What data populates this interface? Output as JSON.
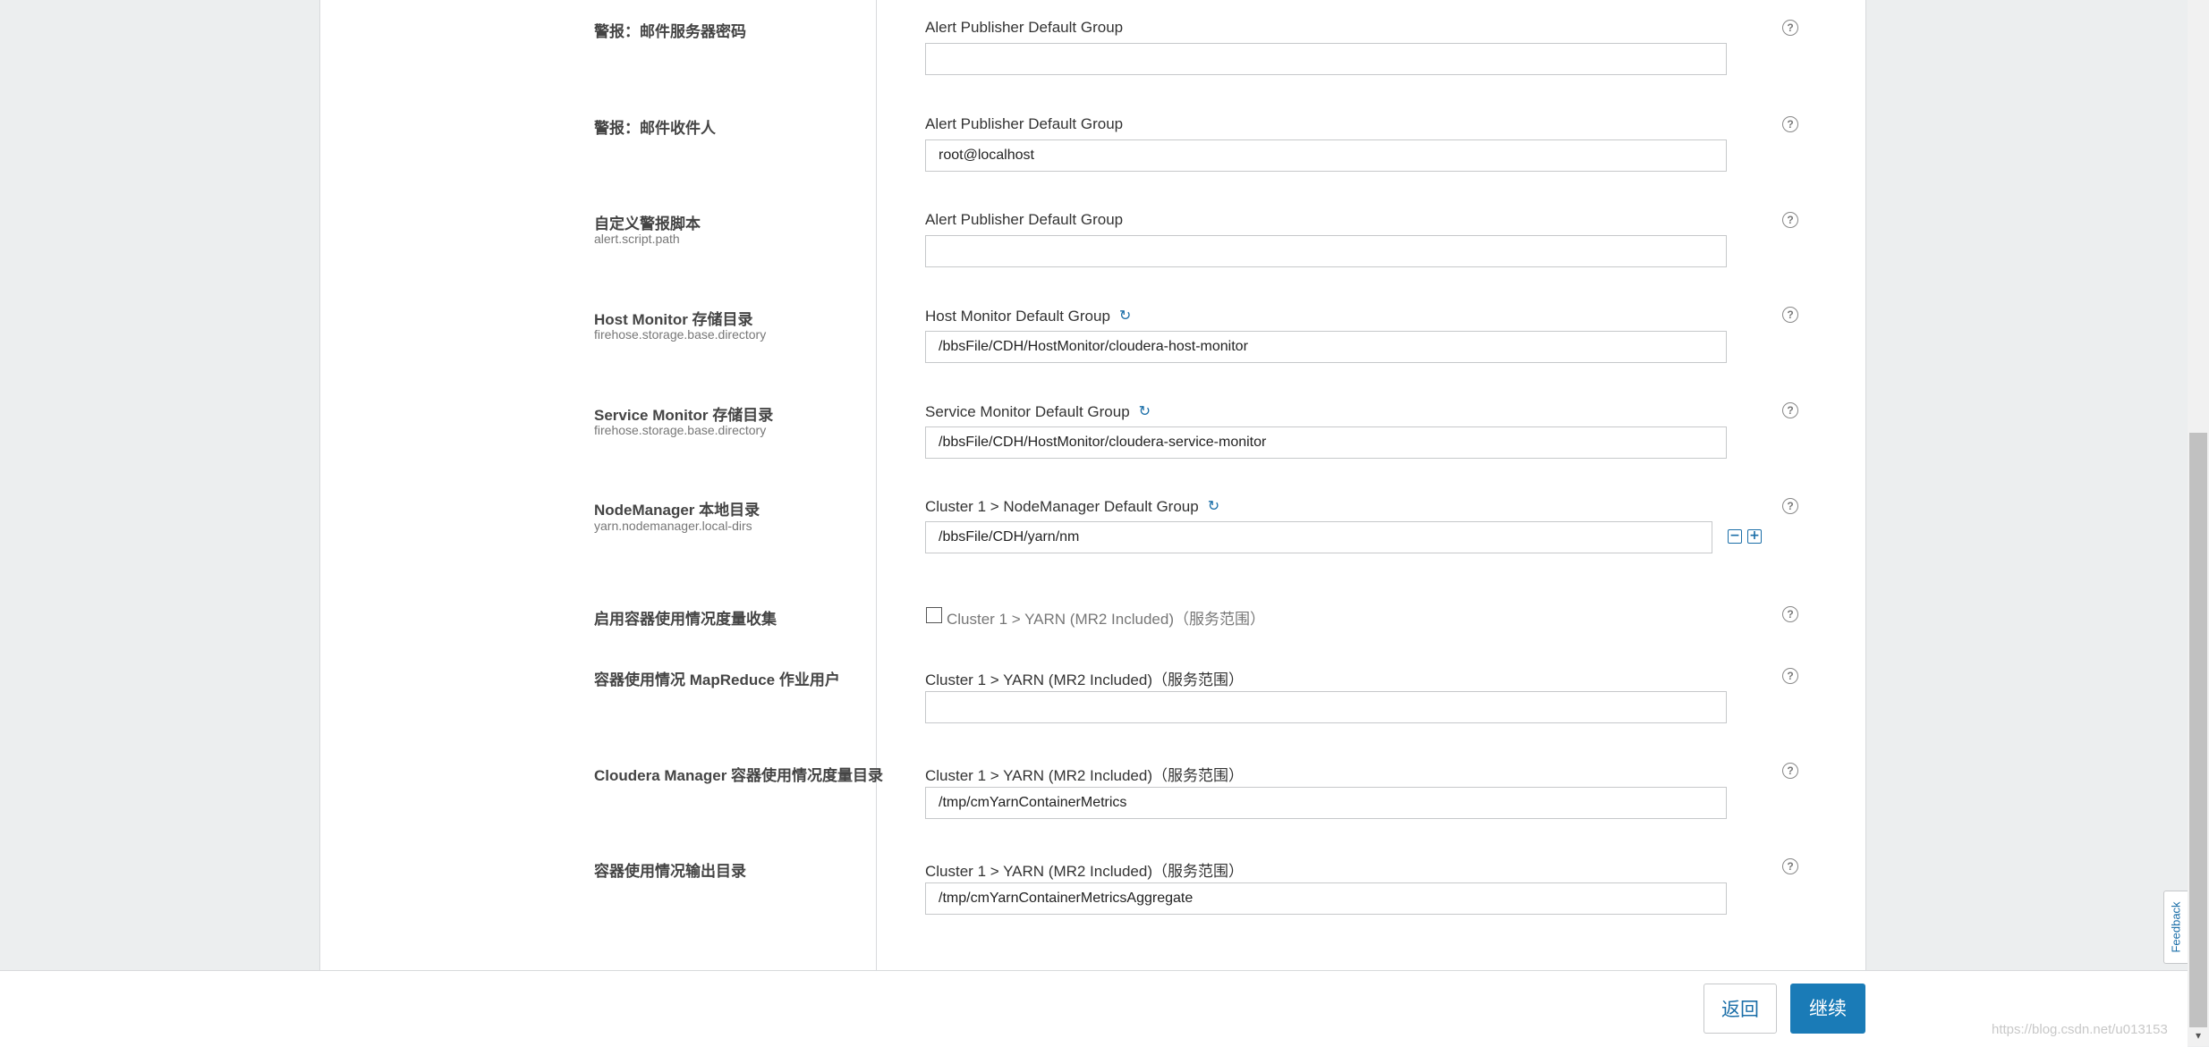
{
  "rows": [
    {
      "label": "警报：邮件服务器密码",
      "sublabel": "",
      "group": "Alert Publisher Default Group",
      "value": ""
    },
    {
      "label": "警报：邮件收件人",
      "sublabel": "",
      "group": "Alert Publisher Default Group",
      "value": "root@localhost"
    },
    {
      "label": "自定义警报脚本",
      "sublabel": "alert.script.path",
      "group": "Alert Publisher Default Group",
      "value": ""
    },
    {
      "label": "Host Monitor 存储目录",
      "sublabel": "firehose.storage.base.directory",
      "group": "Host Monitor Default Group",
      "value": "/bbsFile/CDH/HostMonitor/cloudera-host-monitor"
    },
    {
      "label": "Service Monitor 存储目录",
      "sublabel": "firehose.storage.base.directory",
      "group": "Service Monitor Default Group",
      "value": "/bbsFile/CDH/HostMonitor/cloudera-service-monitor"
    },
    {
      "label": "NodeManager 本地目录",
      "sublabel": "yarn.nodemanager.local-dirs",
      "group": "Cluster 1 > NodeManager Default Group",
      "value": "/bbsFile/CDH/yarn/nm"
    },
    {
      "label": "启用容器使用情况度量收集",
      "sublabel": "",
      "group": "Cluster 1 > YARN (MR2 Included)（服务范围）",
      "value": ""
    },
    {
      "label": "容器使用情况 MapReduce 作业用户",
      "sublabel": "",
      "group": "Cluster 1 > YARN (MR2 Included)（服务范围）",
      "value": ""
    },
    {
      "label": "Cloudera Manager 容器使用情况度量目录",
      "sublabel": "",
      "group": "Cluster 1 > YARN (MR2 Included)（服务范围）",
      "value": "/tmp/cmYarnContainerMetrics"
    },
    {
      "label": "容器使用情况输出目录",
      "sublabel": "",
      "group": "Cluster 1 > YARN (MR2 Included)（服务范围）",
      "value": "/tmp/cmYarnContainerMetricsAggregate"
    }
  ],
  "icons": {
    "help": "?",
    "reset": "↻",
    "remove": "−",
    "add": "+"
  },
  "footer": {
    "back_label": "返回",
    "continue_label": "继续"
  },
  "feedback_label": "Feedback",
  "watermark": "https://blog.csdn.net/u013153",
  "colors": {
    "accent": "#1a7bb7",
    "background": "#eceeef",
    "panel": "#ffffff"
  }
}
